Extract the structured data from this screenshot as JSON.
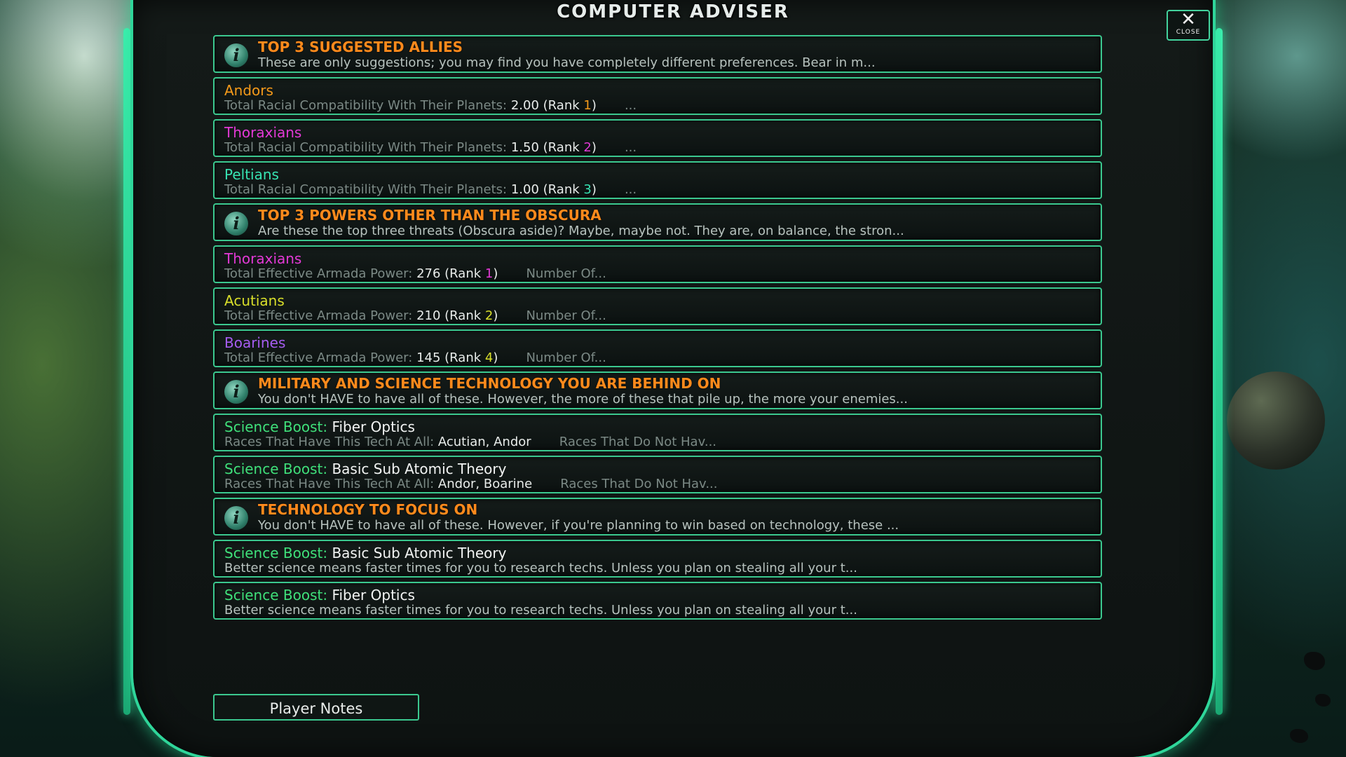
{
  "window": {
    "title": "COMPUTER ADVISER",
    "close_label": "CLOSE"
  },
  "rows": [
    {
      "kind": "header",
      "title": "TOP 3 SUGGESTED ALLIES",
      "desc": "These are only suggestions; you may find you have completely different preferences.        Bear in m..."
    },
    {
      "kind": "entry",
      "name": "Andors",
      "color": "#f59a1a",
      "detail_label": "Total Racial Compatibility With Their Planets:",
      "detail_value": "2.00",
      "rank_label": "(Rank",
      "rank_value": "1",
      "rank_color": "#f59a1a",
      "rank_close": ")",
      "more": "..."
    },
    {
      "kind": "entry",
      "name": "Thoraxians",
      "color": "#e339d6",
      "detail_label": "Total Racial Compatibility With Their Planets:",
      "detail_value": "1.50",
      "rank_label": "(Rank",
      "rank_value": "2",
      "rank_color": "#e339d6",
      "rank_close": ")",
      "more": "..."
    },
    {
      "kind": "entry",
      "name": "Peltians",
      "color": "#37e3b2",
      "detail_label": "Total Racial Compatibility With Their Planets:",
      "detail_value": "1.00",
      "rank_label": "(Rank",
      "rank_value": "3",
      "rank_color": "#37e3b2",
      "rank_close": ")",
      "more": "..."
    },
    {
      "kind": "header",
      "title": "TOP 3 POWERS OTHER THAN THE OBSCURA",
      "desc": "Are these the top three threats (Obscura aside)?  Maybe, maybe not.  They are, on balance, the stron..."
    },
    {
      "kind": "entry",
      "name": "Thoraxians",
      "color": "#e339d6",
      "detail_label": "Total Effective Armada Power:",
      "detail_value": "276",
      "rank_label": "(Rank",
      "rank_value": "1",
      "rank_color": "#e339d6",
      "rank_close": ")",
      "more": "Number Of..."
    },
    {
      "kind": "entry",
      "name": "Acutians",
      "color": "#d9df2a",
      "detail_label": "Total Effective Armada Power:",
      "detail_value": "210",
      "rank_label": "(Rank",
      "rank_value": "2",
      "rank_color": "#d9df2a",
      "rank_close": ")",
      "more": "Number Of..."
    },
    {
      "kind": "entry",
      "name": "Boarines",
      "color": "#a55cf0",
      "detail_label": "Total Effective Armada Power:",
      "detail_value": "145",
      "rank_label": "(Rank",
      "rank_value": "4",
      "rank_color": "#d9df2a",
      "rank_close": ")",
      "more": "Number Of..."
    },
    {
      "kind": "header",
      "title": "MILITARY AND SCIENCE TECHNOLOGY YOU ARE BEHIND ON",
      "desc": "You don't HAVE to have all of these.  However, the more of these that pile up, the more your enemies..."
    },
    {
      "kind": "tech",
      "prefix": "Science Boost:",
      "name": "Fiber Optics",
      "detail_label": "Races That Have This Tech At All:",
      "detail_value": "Acutian, Andor",
      "more": "Races That Do Not Hav..."
    },
    {
      "kind": "tech",
      "prefix": "Science Boost:",
      "name": "Basic Sub Atomic Theory",
      "detail_label": "Races That Have This Tech At All:",
      "detail_value": "Andor, Boarine",
      "more": "Races That Do Not Hav..."
    },
    {
      "kind": "header",
      "title": "TECHNOLOGY TO FOCUS ON",
      "desc": "You don't HAVE to have all of these.  However, if you're planning to win based on technology, these ..."
    },
    {
      "kind": "tech2",
      "prefix": "Science Boost:",
      "name": "Basic Sub Atomic Theory",
      "desc": "Better science means faster times for you to research techs.  Unless you plan on stealing all your t..."
    },
    {
      "kind": "tech2",
      "prefix": "Science Boost:",
      "name": "Fiber Optics",
      "desc": "Better science means faster times for you to research techs.  Unless you plan on stealing all your t..."
    }
  ],
  "footer": {
    "player_notes_label": "Player Notes"
  },
  "icons": {
    "info": "info-icon",
    "close": "close-icon"
  },
  "colors": {
    "accent": "#3bc88f",
    "header_title": "#ff8a1c",
    "science_prefix": "#3fe07a"
  }
}
